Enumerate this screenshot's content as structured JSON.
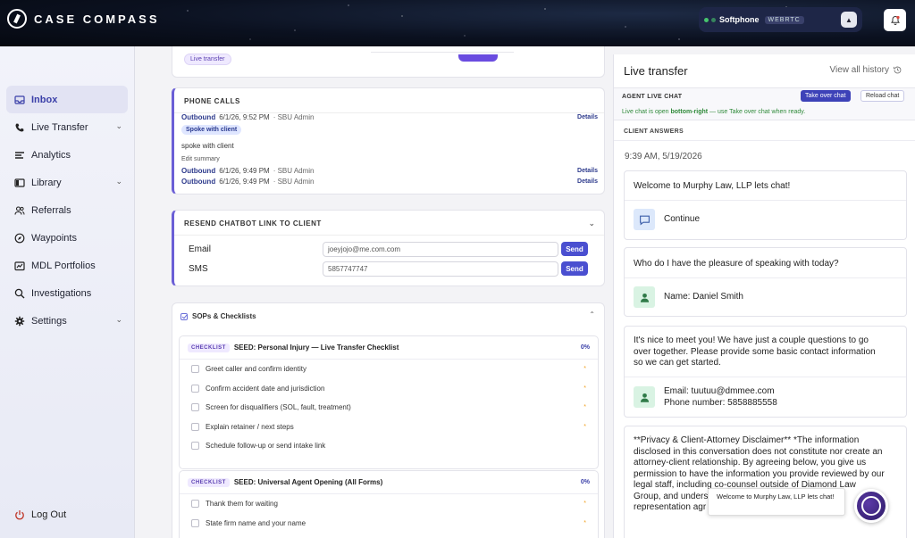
{
  "app": {
    "brand": "CASE COMPASS"
  },
  "softphone": {
    "label": "Softphone",
    "tag": "WEBRTC"
  },
  "sidebar": {
    "items": [
      {
        "label": "Inbox",
        "icon": "inbox-icon",
        "active": true,
        "chevron": false
      },
      {
        "label": "Live Transfer",
        "icon": "phone-icon",
        "active": false,
        "chevron": true
      },
      {
        "label": "Analytics",
        "icon": "analytics-icon",
        "active": false,
        "chevron": false
      },
      {
        "label": "Library",
        "icon": "library-icon",
        "active": false,
        "chevron": true
      },
      {
        "label": "Referrals",
        "icon": "users-icon",
        "active": false,
        "chevron": false
      },
      {
        "label": "Waypoints",
        "icon": "compass-icon",
        "active": false,
        "chevron": false
      },
      {
        "label": "MDL Portfolios",
        "icon": "portfolio-icon",
        "active": false,
        "chevron": false
      },
      {
        "label": "Investigations",
        "icon": "search-icon",
        "active": false,
        "chevron": false
      },
      {
        "label": "Settings",
        "icon": "gear-icon",
        "active": false,
        "chevron": true
      }
    ],
    "logout": "Log Out"
  },
  "top_card": {
    "badge": "Live transfer"
  },
  "phone_calls": {
    "title": "PHONE CALLS",
    "calls": [
      {
        "direction": "Outbound",
        "date": "6/1/26, 9:52 PM",
        "by": "· SBU Admin",
        "details": "Details"
      },
      {
        "direction": "Outbound",
        "date": "6/1/26, 9:49 PM",
        "by": "· SBU Admin",
        "details": "Details"
      },
      {
        "direction": "Outbound",
        "date": "6/1/26, 9:49 PM",
        "by": "· SBU Admin",
        "details": "Details"
      }
    ],
    "chip": "Spoke with client",
    "note": "spoke with client",
    "edit_summary": "Edit summary"
  },
  "resend": {
    "title": "RESEND CHATBOT LINK TO CLIENT",
    "email_label": "Email",
    "email_value": "joeyjojo@me.com.com",
    "sms_label": "SMS",
    "sms_value": "5857747747",
    "send_label": "Send"
  },
  "sops": {
    "title": "SOPs & Checklists",
    "checklists": [
      {
        "tag": "CHECKLIST",
        "title": "SEED: Personal Injury — Live Transfer Checklist",
        "percent": "0%",
        "items": [
          "Greet caller and confirm identity",
          "Confirm accident date and jurisdiction",
          "Screen for disqualifiers (SOL, fault, treatment)",
          "Explain retainer / next steps",
          "Schedule follow-up or send intake link"
        ],
        "required": [
          "*",
          "*",
          "*",
          "*",
          ""
        ]
      },
      {
        "tag": "CHECKLIST",
        "title": "SEED: Universal Agent Opening (All Forms)",
        "percent": "0%",
        "items": [
          "Thank them for waiting",
          "State firm name and your name"
        ],
        "required": [
          "*",
          "*"
        ]
      }
    ]
  },
  "live_transfer": {
    "title": "Live transfer",
    "view_history": "View all history",
    "agent_live_chat": "AGENT LIVE CHAT",
    "take_over": "Take over chat",
    "reload": "Reload chat",
    "status_prefix": "Live chat is open ",
    "status_bold": "bottom-right",
    "status_suffix": " — use Take over chat when ready.",
    "client_answers": "CLIENT ANSWERS",
    "timestamp": "9:39 AM, 5/19/2026",
    "messages": [
      {
        "question": "Welcome to Murphy Law, LLP lets chat!",
        "answer": "Continue"
      },
      {
        "question": "Who do I have the pleasure of speaking with today?",
        "answer": "Name: Daniel Smith"
      },
      {
        "question_lines": [
          "It's nice to meet you! We have just a couple questions to go",
          "over together. Please provide some basic contact information",
          "so we can get started."
        ],
        "answer_lines": [
          "Email: tuutuu@dmmee.com",
          "Phone number: 5858885558"
        ]
      },
      {
        "question_lines": [
          "**Privacy & Client-Attorney Disclaimer** *The information",
          "disclosed in this conversation does not constitute nor create an",
          "attorney-client relationship. By agreeing below, you give us",
          "permission to have the information you provide reviewed by our",
          "legal staff, including co-counsel outside of Diamond Law",
          "Group, and unders",
          "representation agr"
        ]
      }
    ]
  },
  "chat_popup": {
    "text": "Welcome to Murphy Law, LLP lets chat!"
  }
}
